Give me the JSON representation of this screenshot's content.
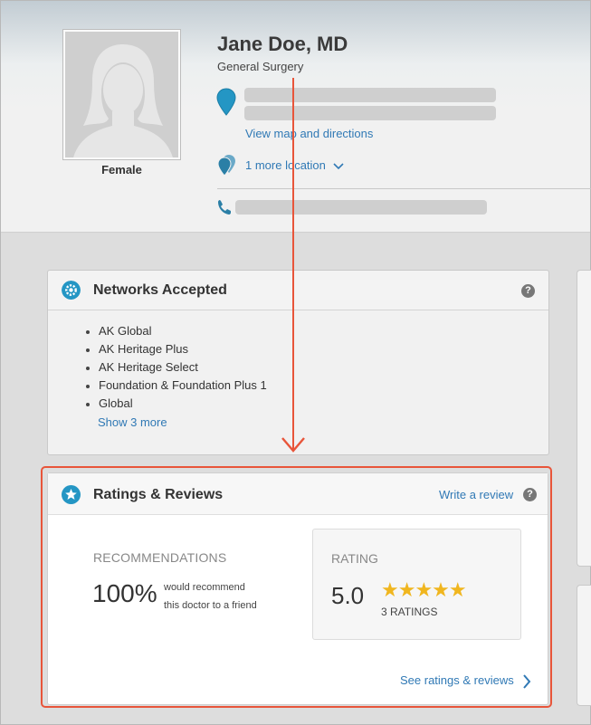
{
  "profile": {
    "name": "Jane Doe, MD",
    "specialty": "General Surgery",
    "gender": "Female",
    "map_link": "View map and directions",
    "more_locations": "1 more location"
  },
  "networks": {
    "title": "Networks Accepted",
    "items": [
      "AK Global",
      "AK Heritage Plus",
      "AK Heritage Select",
      "Foundation & Foundation Plus 1",
      "Global"
    ],
    "show_more": "Show 3 more"
  },
  "ratings": {
    "title": "Ratings & Reviews",
    "write_review": "Write a review",
    "recommendations_label": "RECOMMENDATIONS",
    "recommend_pct": "100%",
    "recommend_line1": "would recommend",
    "recommend_line2": "this doctor to a friend",
    "rating_label": "RATING",
    "rating_value": "5.0",
    "stars": "★★★★★",
    "star_count": 5,
    "rating_count": "3 RATINGS",
    "see_link": "See ratings & reviews"
  },
  "colors": {
    "accent_blue": "#2496c4",
    "link_blue": "#3079b5",
    "highlight_red": "#e8553a",
    "star_gold": "#f0b61f"
  }
}
